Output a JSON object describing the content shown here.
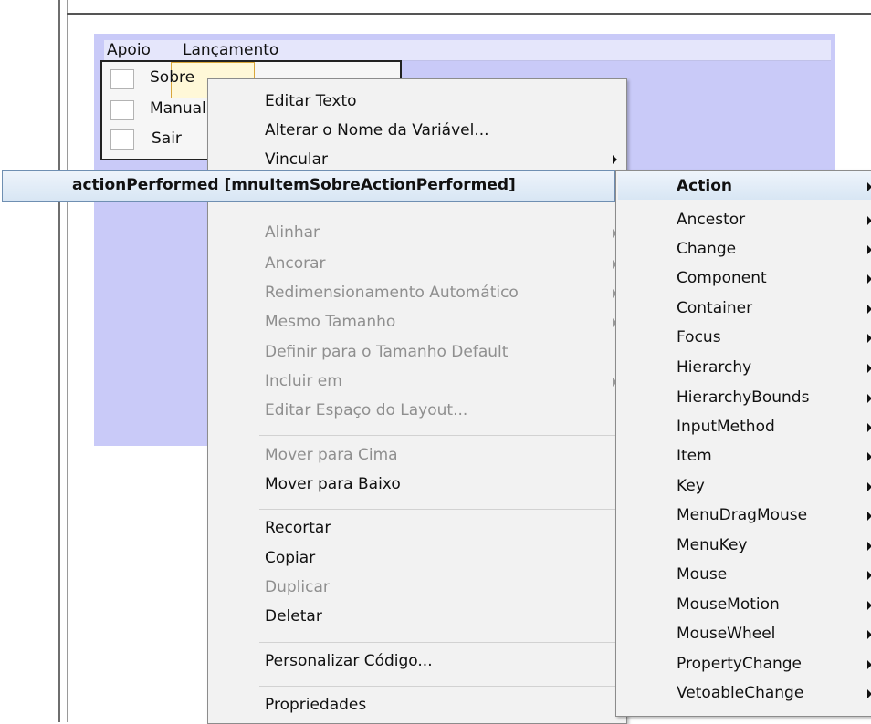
{
  "menubar": {
    "items": [
      "Apoio",
      "Lançamento"
    ]
  },
  "menu_popup": {
    "items": [
      "Sobre",
      "Manual",
      "Sair"
    ]
  },
  "context_menu": {
    "items": [
      {
        "label": "Editar Texto",
        "disabled": false,
        "submenu": false
      },
      {
        "label": "Alterar o Nome da Variável...",
        "disabled": false,
        "submenu": false
      },
      {
        "label": "Vincular",
        "disabled": false,
        "submenu": true
      },
      {
        "label": "Alinhar",
        "disabled": true,
        "submenu": true
      },
      {
        "label": "Ancorar",
        "disabled": true,
        "submenu": true
      },
      {
        "label": "Redimensionamento Automático",
        "disabled": true,
        "submenu": true
      },
      {
        "label": "Mesmo Tamanho",
        "disabled": true,
        "submenu": true
      },
      {
        "label": "Definir para o Tamanho Default",
        "disabled": true,
        "submenu": false
      },
      {
        "label": "Incluir em",
        "disabled": true,
        "submenu": true
      },
      {
        "label": "Editar Espaço do Layout...",
        "disabled": true,
        "submenu": false
      },
      {
        "label": "Mover para Cima",
        "disabled": true,
        "submenu": false
      },
      {
        "label": "Mover para Baixo",
        "disabled": false,
        "submenu": false
      },
      {
        "label": "Recortar",
        "disabled": false,
        "submenu": false
      },
      {
        "label": "Copiar",
        "disabled": false,
        "submenu": false
      },
      {
        "label": "Duplicar",
        "disabled": true,
        "submenu": false
      },
      {
        "label": "Deletar",
        "disabled": false,
        "submenu": false
      },
      {
        "label": "Personalizar Código...",
        "disabled": false,
        "submenu": false
      },
      {
        "label": "Propriedades",
        "disabled": false,
        "submenu": false
      }
    ]
  },
  "vincular_submenu": {
    "item": "actionPerformed [mnuItemSobreActionPerformed]"
  },
  "events_submenu": {
    "items": [
      "Action",
      "Ancestor",
      "Change",
      "Component",
      "Container",
      "Focus",
      "Hierarchy",
      "HierarchyBounds",
      "InputMethod",
      "Item",
      "Key",
      "MenuDragMouse",
      "MenuKey",
      "Mouse",
      "MouseMotion",
      "MouseWheel",
      "PropertyChange",
      "VetoableChange"
    ]
  },
  "colors": {
    "form_background": "#c9caf8",
    "menu_background": "#f2f2f2",
    "disabled_text": "#8f8f8f",
    "highlight": "#d8e6f4"
  }
}
